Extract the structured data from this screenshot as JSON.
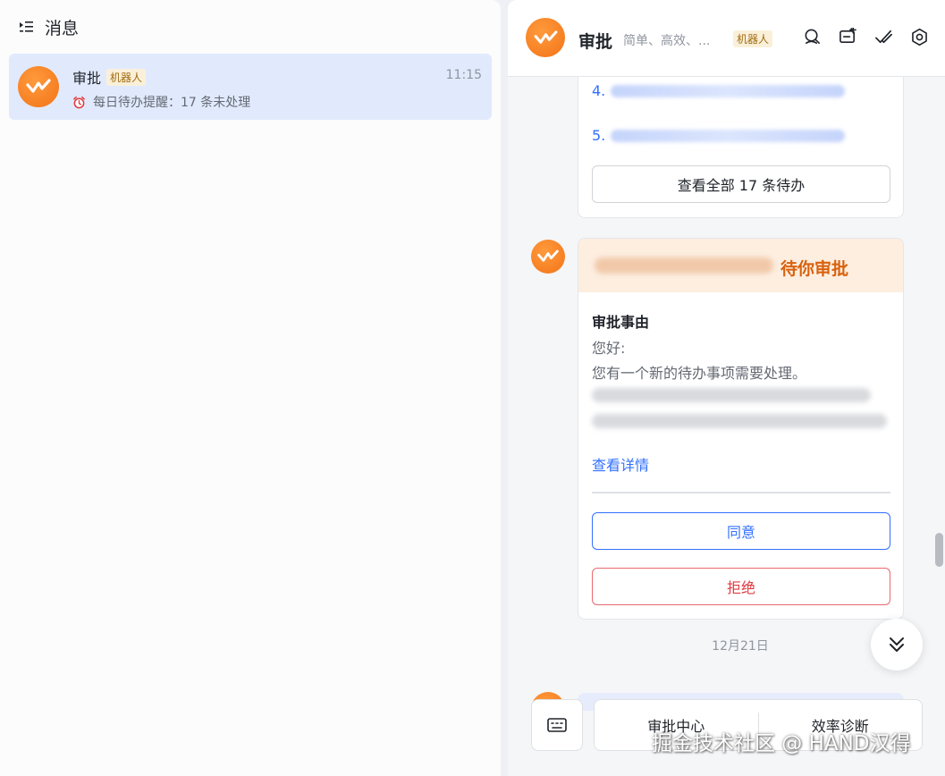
{
  "left": {
    "title": "消息",
    "conversation": {
      "name": "审批",
      "badge": "机器人",
      "time": "11:15",
      "preview": "每日待办提醒：17 条未处理"
    }
  },
  "right": {
    "header": {
      "name": "审批",
      "desc": "简单、高效、...",
      "badge": "机器人",
      "icons": [
        "search-chat-icon",
        "add-chat-icon",
        "check-icon",
        "settings-icon"
      ]
    },
    "todo_card": {
      "items": [
        "4.",
        "5."
      ],
      "view_all": "查看全部 17 条待办"
    },
    "approval_card": {
      "head_title": "待你审批",
      "section_title": "审批事由",
      "greeting": "您好:",
      "body": "您有一个新的待办事项需要处理。",
      "link": "查看详情",
      "agree": "同意",
      "reject": "拒绝"
    },
    "date_divider": "12月21日",
    "quick_actions": [
      "审批中心",
      "效率诊断"
    ]
  },
  "watermark": "掘金技术社区 @ HAND汉得",
  "colors": {
    "accent": "#3370ff",
    "brand_orange": "#f27418",
    "reject": "#e03a40",
    "selected_bg": "#e1eafd"
  }
}
